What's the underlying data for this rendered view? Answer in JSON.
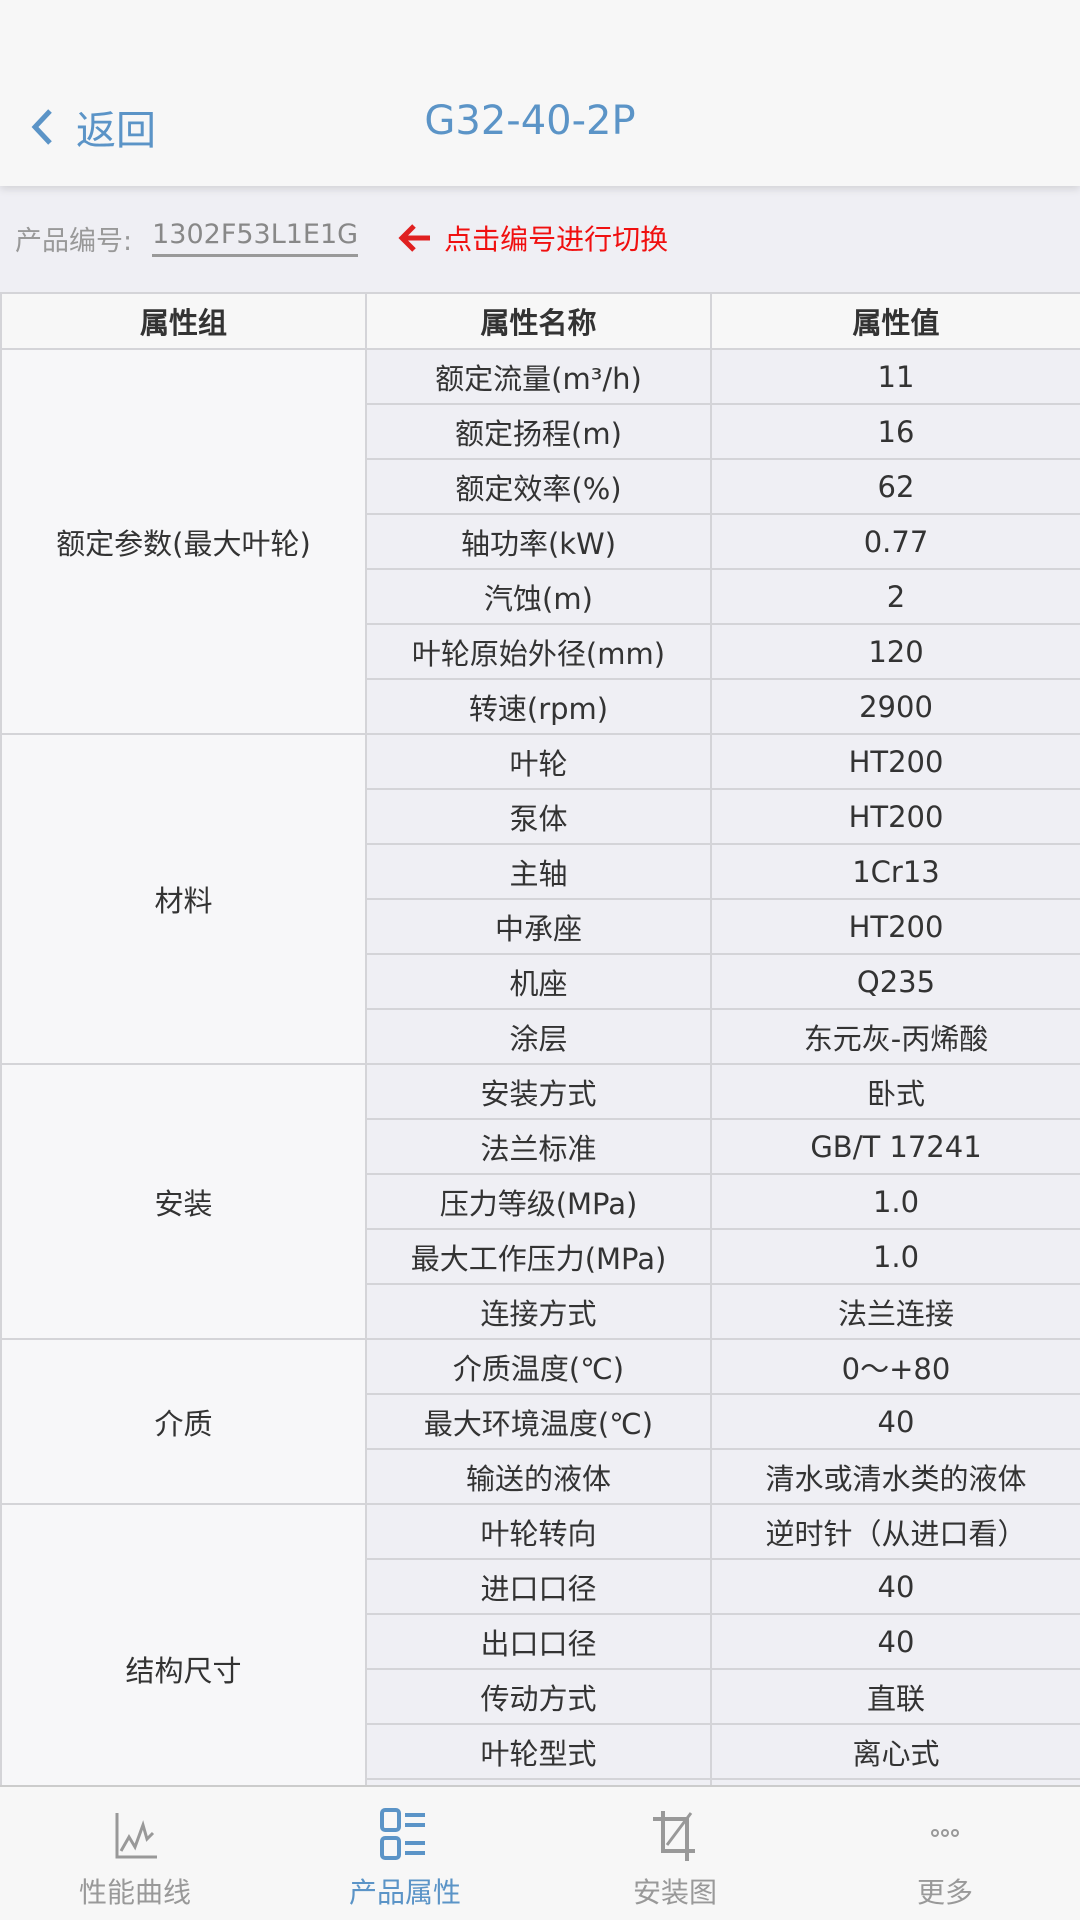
{
  "header": {
    "back_label": "返回",
    "title": "G32-40-2P"
  },
  "product": {
    "code_label": "产品编号:",
    "code_value": "1302F53L1E1G",
    "hint": "点击编号进行切换"
  },
  "table": {
    "columns": [
      "属性组",
      "属性名称",
      "属性值"
    ],
    "groups": [
      {
        "name": "额定参数(最大叶轮)",
        "rows": [
          [
            "额定流量(m³/h)",
            "11"
          ],
          [
            "额定扬程(m)",
            "16"
          ],
          [
            "额定效率(%)",
            "62"
          ],
          [
            "轴功率(kW)",
            "0.77"
          ],
          [
            "汽蚀(m)",
            "2"
          ],
          [
            "叶轮原始外径(mm)",
            "120"
          ],
          [
            "转速(rpm)",
            "2900"
          ]
        ]
      },
      {
        "name": "材料",
        "rows": [
          [
            "叶轮",
            "HT200"
          ],
          [
            "泵体",
            "HT200"
          ],
          [
            "主轴",
            "1Cr13"
          ],
          [
            "中承座",
            "HT200"
          ],
          [
            "机座",
            "Q235"
          ],
          [
            "涂层",
            "东元灰-丙烯酸"
          ]
        ]
      },
      {
        "name": "安装",
        "rows": [
          [
            "安装方式",
            "卧式"
          ],
          [
            "法兰标准",
            "GB/T 17241"
          ],
          [
            "压力等级(MPa)",
            "1.0"
          ],
          [
            "最大工作压力(MPa)",
            "1.0"
          ],
          [
            "连接方式",
            "法兰连接"
          ]
        ]
      },
      {
        "name": "介质",
        "rows": [
          [
            "介质温度(℃)",
            "0～+80"
          ],
          [
            "最大环境温度(℃)",
            "40"
          ],
          [
            "输送的液体",
            "清水或清水类的液体"
          ]
        ]
      },
      {
        "name": "结构尺寸",
        "rows": [
          [
            "叶轮转向",
            "逆时针（从进口看）"
          ],
          [
            "进口口径",
            "40"
          ],
          [
            "出口口径",
            "40"
          ],
          [
            "传动方式",
            "直联"
          ],
          [
            "叶轮型式",
            "离心式"
          ],
          [
            "",
            ""
          ]
        ]
      }
    ]
  },
  "tabs": [
    {
      "label": "性能曲线",
      "icon": "chart-line-icon",
      "active": false
    },
    {
      "label": "产品属性",
      "icon": "list-icon",
      "active": true
    },
    {
      "label": "安装图",
      "icon": "crop-icon",
      "active": false
    },
    {
      "label": "更多",
      "icon": "more-icon",
      "active": false
    }
  ],
  "colors": {
    "accent": "#5b94c7",
    "hint": "#f01010"
  }
}
